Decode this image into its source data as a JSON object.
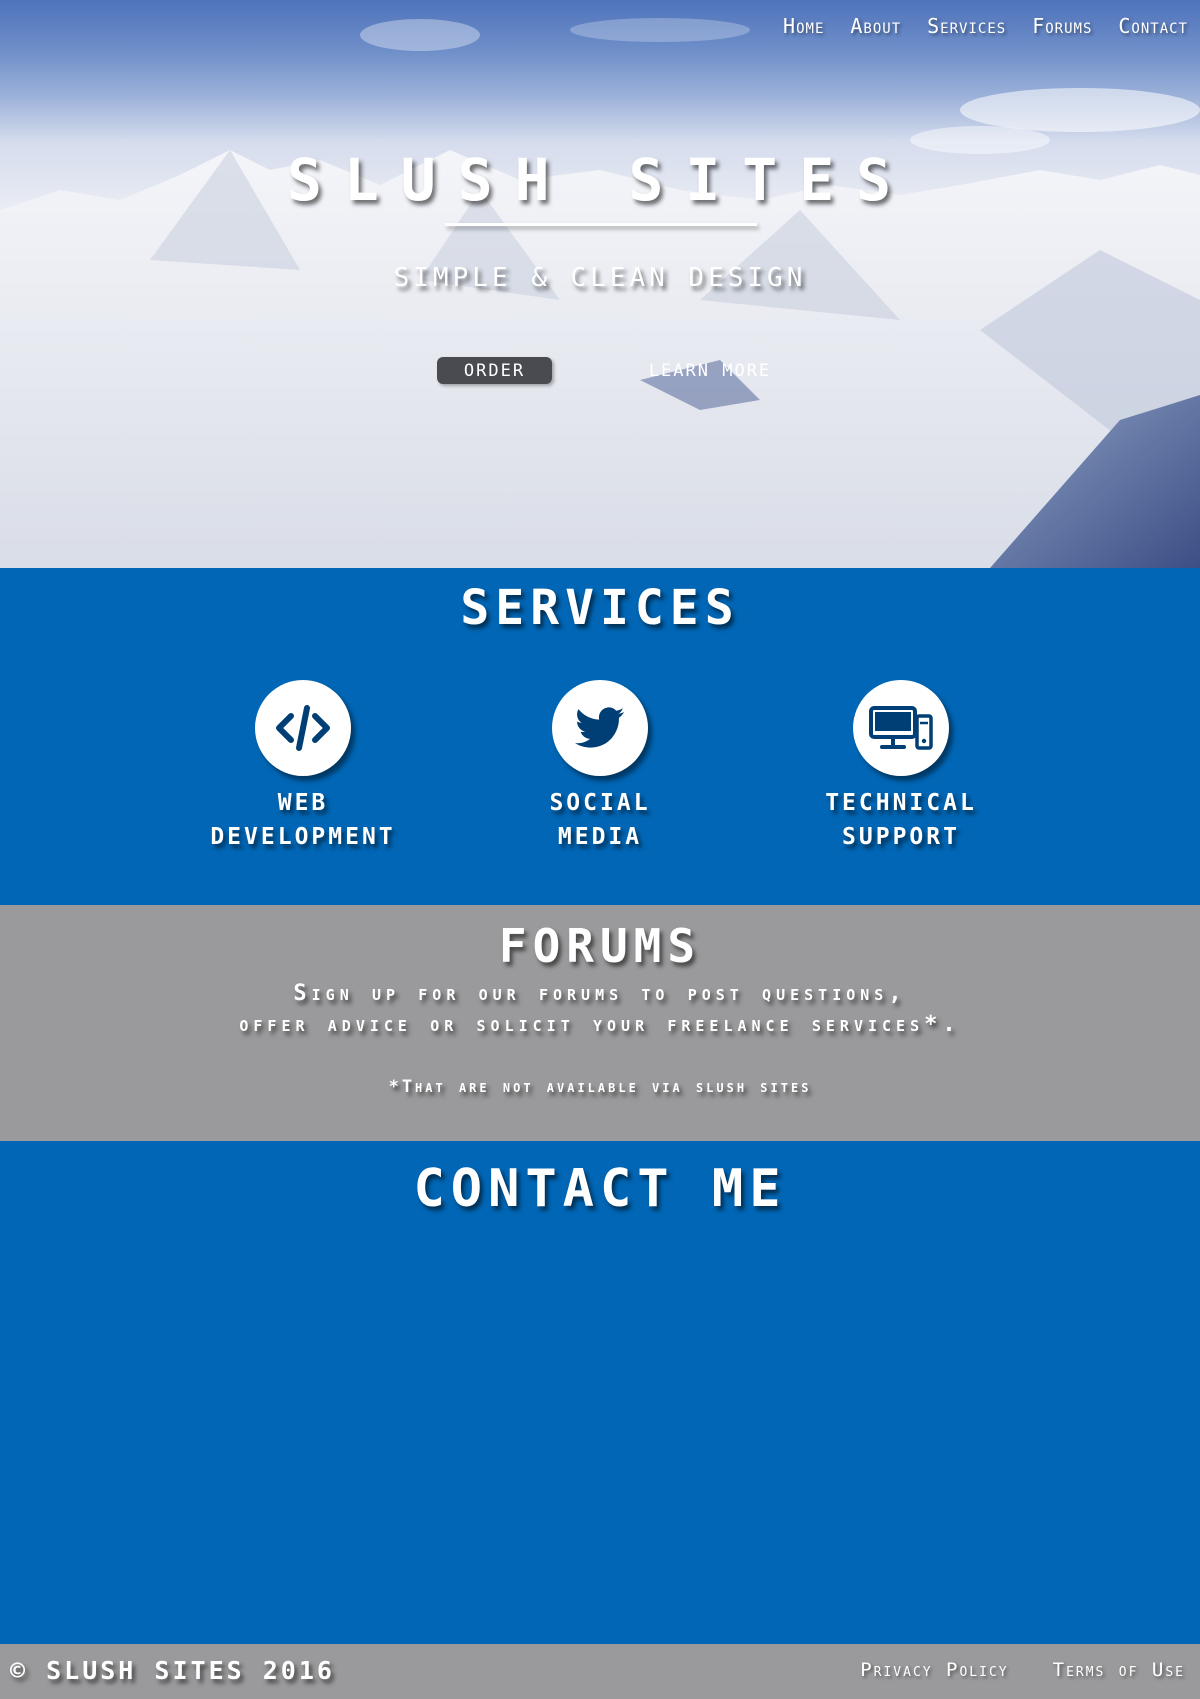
{
  "nav": {
    "items": [
      "Home",
      "About",
      "Services",
      "Forums",
      "Contact"
    ]
  },
  "hero": {
    "title": "SLUSH SITES",
    "subtitle": "SIMPLE & CLEAN DESIGN",
    "order_label": "ORDER",
    "learn_more_label": "LEARN MORE"
  },
  "services": {
    "title": "SERVICES",
    "items": [
      {
        "line1": "WEB",
        "line2": "DEVELOPMENT",
        "icon": "code-icon"
      },
      {
        "line1": "SOCIAL",
        "line2": "MEDIA",
        "icon": "twitter-bird-icon"
      },
      {
        "line1": "TECHNICAL",
        "line2": "SUPPORT",
        "icon": "devices-icon"
      }
    ]
  },
  "forums": {
    "title": "FORUMS",
    "line1": "Sign up for our forums to post questions,",
    "line2": "offer advice or solicit your freelance services*.",
    "note": "*That are not available via slush sites"
  },
  "contact": {
    "title": "CONTACT ME"
  },
  "footer": {
    "copyright": "© SLUSH SITES 2016",
    "privacy": "Privacy Policy",
    "terms": "Terms of Use"
  },
  "colors": {
    "primary_blue": "#0066b5",
    "gray_band": "#9a999b",
    "order_button": "#4a4b50",
    "icon_blue": "#003f75"
  }
}
